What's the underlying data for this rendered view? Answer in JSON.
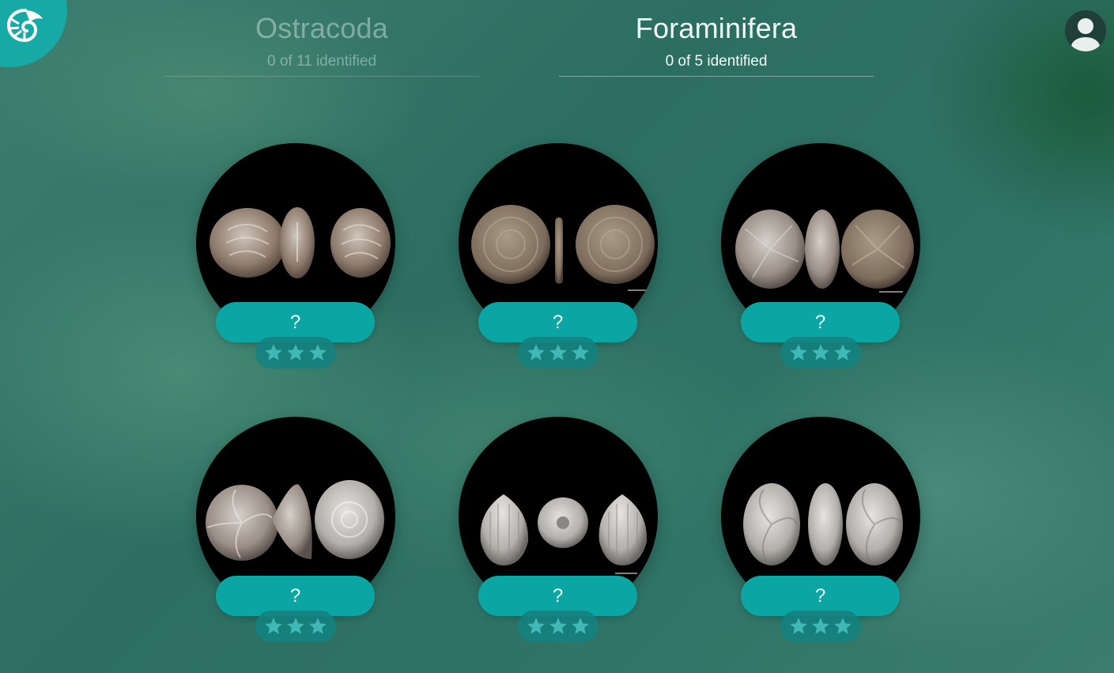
{
  "header": {
    "tabs": [
      {
        "title": "Ostracoda",
        "progress": "0 of 11 identified",
        "active": false
      },
      {
        "title": "Foraminifera",
        "progress": "0 of 5 identified",
        "active": true
      }
    ]
  },
  "logo": {
    "icon": "nautilus-shell-icon"
  },
  "user": {
    "icon": "user-avatar-icon"
  },
  "specimens": [
    {
      "answer": "?",
      "stars_earned": 0,
      "stars_total": 3
    },
    {
      "answer": "?",
      "stars_earned": 0,
      "stars_total": 3
    },
    {
      "answer": "?",
      "stars_earned": 0,
      "stars_total": 3
    },
    {
      "answer": "?",
      "stars_earned": 0,
      "stars_total": 3
    },
    {
      "answer": "?",
      "stars_earned": 0,
      "stars_total": 3
    },
    {
      "answer": "?",
      "stars_earned": 0,
      "stars_total": 3
    }
  ],
  "colors": {
    "accent": "#0ba6a4",
    "star_off": "#3fb8b6",
    "star_badge": "#148280"
  }
}
